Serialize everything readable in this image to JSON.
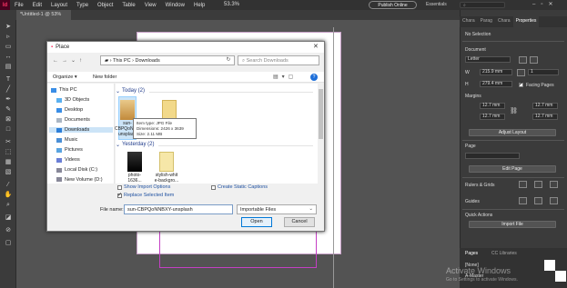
{
  "app": {
    "logo": "Id",
    "menu": [
      "File",
      "Edit",
      "Layout",
      "Type",
      "Object",
      "Table",
      "View",
      "Window",
      "Help"
    ],
    "zoom": "53.3%",
    "publish_label": "Publish Online",
    "workspace": "Essentials",
    "doc_tab": "*Untitled-1 @ 53%"
  },
  "right_panel": {
    "tabs": [
      "Chara",
      "Parag",
      "Chara",
      "Properties"
    ],
    "no_selection": "No Selection",
    "document_label": "Document",
    "preset": "Letter",
    "width_label": "W",
    "width": "215.9 mm",
    "height_label": "H",
    "height": "279.4 mm",
    "pages_value": "1",
    "facing_pages": "Facing Pages",
    "margins_label": "Margins",
    "margin_values": [
      "12.7 mm",
      "12.7 mm",
      "12.7 mm",
      "12.7 mm"
    ],
    "adjust_layout": "Adjust Layout",
    "page_label": "Page",
    "edit_page": "Edit Page",
    "rulers_grids": "Rulers & Grids",
    "guides": "Guides",
    "quick_actions": "Quick Actions",
    "import_file": "Import File",
    "pages_tabs": [
      "Pages",
      "CC Libraries"
    ],
    "pages_none": "[None]",
    "pages_master": "A-Master",
    "activate_title": "Activate Windows",
    "activate_sub": "Go to Settings to activate Windows."
  },
  "dialog": {
    "title": "Place",
    "breadcrumb": [
      "This PC",
      "Downloads"
    ],
    "search_placeholder": "Search Downloads",
    "organize": "Organize ▾",
    "new_folder": "New folder",
    "help": "?",
    "nav_items": [
      "This PC",
      "3D Objects",
      "Desktop",
      "Documents",
      "Downloads",
      "Music",
      "Pictures",
      "Videos",
      "Local Disk (C:)",
      "New Volume (D:)"
    ],
    "groups": [
      {
        "label": "Today (2)",
        "files": [
          "sun-CBPQoNNBXY-unsplash",
          "..."
        ]
      },
      {
        "label": "Yesterday (2)",
        "files": [
          "photo-1636...",
          "stylish-whit e-backgro..."
        ]
      }
    ],
    "tooltip": {
      "type": "Item type: JPG File",
      "dimensions": "Dimensions: 2426 x 3639",
      "size": "Size: 2.11 MB"
    },
    "show_import_options": "Show Import Options",
    "replace_selected": "Replace Selected Item",
    "create_static_captions": "Create Static Captions",
    "file_name_label": "File name:",
    "file_name": "sun-CBPQoNNBXY-unsplash",
    "file_type": "Importable Files",
    "open": "Open",
    "cancel": "Cancel"
  }
}
